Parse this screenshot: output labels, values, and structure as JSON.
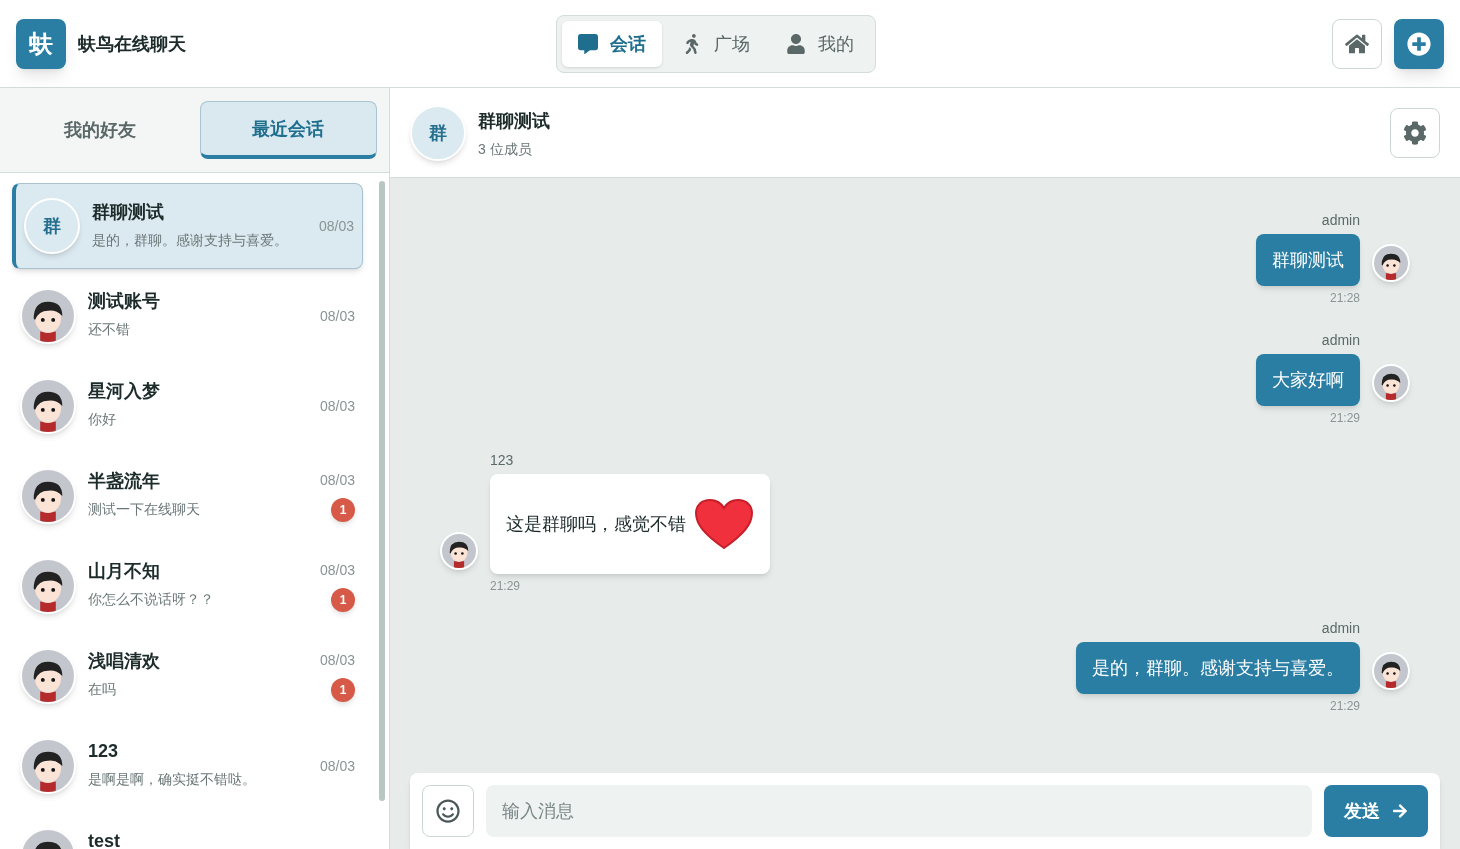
{
  "app": {
    "logo": "蚨",
    "title": "蚨鸟在线聊天"
  },
  "nav_tabs": [
    {
      "label": "会话",
      "selected": true
    },
    {
      "label": "广场",
      "selected": false
    },
    {
      "label": "我的",
      "selected": false
    }
  ],
  "sidebar": {
    "tabs": [
      {
        "label": "我的好友",
        "selected": false
      },
      {
        "label": "最近会话",
        "selected": true
      }
    ],
    "conversations": [
      {
        "name": "群聊测试",
        "preview": "是的，群聊。感谢支持与喜爱。",
        "date": "08/03",
        "selected": true,
        "avatar": {
          "kind": "group",
          "text": "群"
        }
      },
      {
        "name": "测试账号",
        "preview": "还不错",
        "date": "08/03",
        "selected": false,
        "avatar": {
          "kind": "person"
        }
      },
      {
        "name": "星河入梦",
        "preview": "你好",
        "date": "08/03",
        "selected": false,
        "avatar": {
          "kind": "person"
        }
      },
      {
        "name": "半盏流年",
        "preview": "测试一下在线聊天",
        "date": "08/03",
        "unread": "1",
        "selected": false,
        "avatar": {
          "kind": "person"
        }
      },
      {
        "name": "山月不知",
        "preview": "你怎么不说话呀？？",
        "date": "08/03",
        "unread": "1",
        "selected": false,
        "avatar": {
          "kind": "person"
        }
      },
      {
        "name": "浅唱清欢",
        "preview": "在吗",
        "date": "08/03",
        "unread": "1",
        "selected": false,
        "avatar": {
          "kind": "person"
        }
      },
      {
        "name": "123",
        "preview": "是啊是啊，确实挺不错哒。",
        "date": "08/03",
        "selected": false,
        "avatar": {
          "kind": "person"
        }
      },
      {
        "name": "test",
        "selected": false,
        "avatar": {
          "kind": "person"
        }
      }
    ]
  },
  "chat": {
    "avatar_text": "群",
    "title": "群聊测试",
    "subtitle": "3 位成员",
    "messages": [
      {
        "kind": "sent",
        "sender": "admin",
        "text": "群聊测试",
        "time": "21:28"
      },
      {
        "kind": "sent",
        "sender": "admin",
        "text": "大家好啊",
        "time": "21:29"
      },
      {
        "kind": "received",
        "sender": "123",
        "text": "这是群聊吗，感觉不错",
        "heart_sticker": true,
        "time": "21:29"
      },
      {
        "kind": "sent",
        "sender": "admin",
        "text": "是的，群聊。感谢支持与喜爱。",
        "time": "21:29"
      }
    ],
    "input": {
      "placeholder": "输入消息"
    },
    "send_button": "发送"
  }
}
